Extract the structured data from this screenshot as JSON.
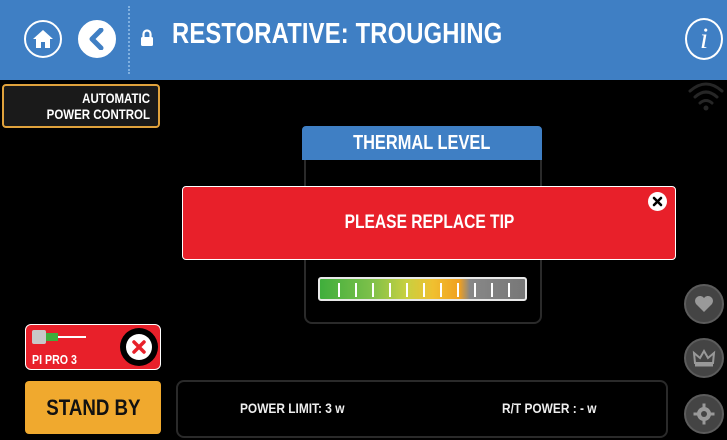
{
  "header": {
    "title": "RESTORATIVE: TROUGHING",
    "info_glyph": "i",
    "color": "#3f7fc4"
  },
  "icons": {
    "home": "home-icon",
    "back": "chevron-left-icon",
    "lock": "lock-icon",
    "info": "info-icon",
    "wifi": "wifi-icon",
    "favorite": "heart-icon",
    "crown": "crown-icon",
    "settings": "gear-icon"
  },
  "apc": {
    "line1": "AUTOMATIC",
    "line2": "POWER CONTROL",
    "border_color": "#e0a23c"
  },
  "thermal": {
    "heading": "THERMAL LEVEL",
    "ticks": 11
  },
  "alert": {
    "message": "PLEASE REPLACE TIP",
    "color": "#e8202a"
  },
  "tip": {
    "name": "PI PRO 3",
    "color": "#e8202a"
  },
  "standby": {
    "label": "STAND BY",
    "color": "#f0a92e"
  },
  "status": {
    "power_limit": "POWER LIMIT: 3 w",
    "rt_power": "R/T POWER : - w"
  }
}
